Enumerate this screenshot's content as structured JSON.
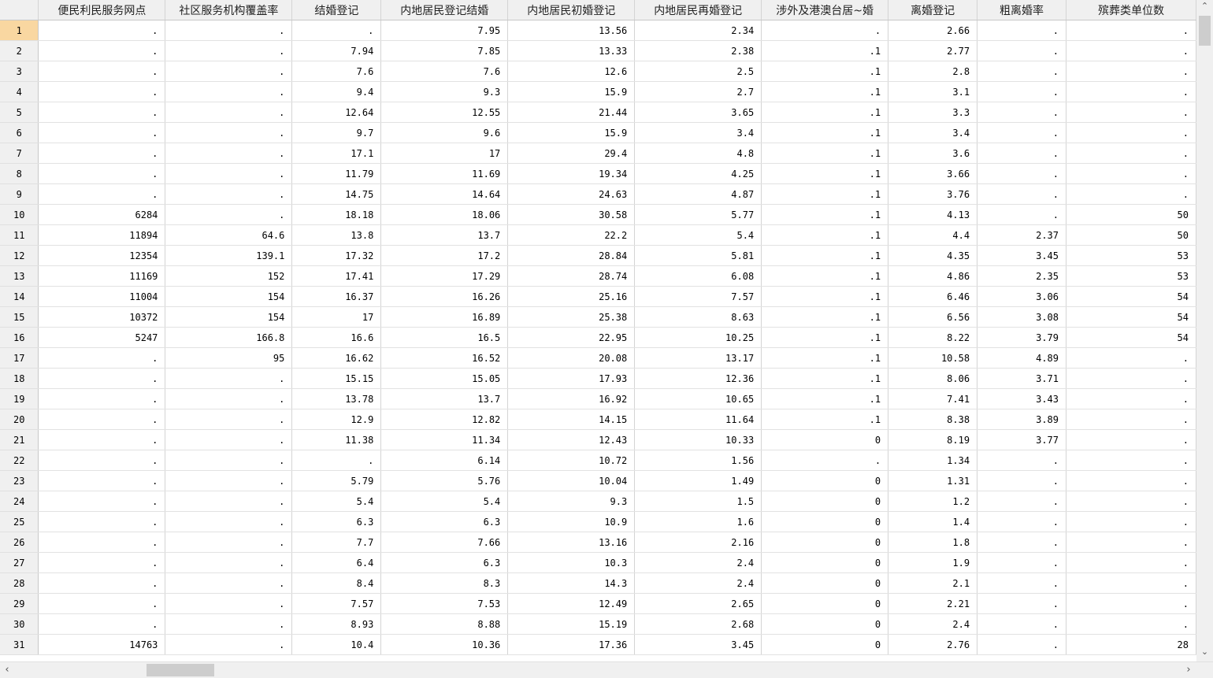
{
  "columns": [
    "便民利民服务网点",
    "社区服务机构覆盖率",
    "结婚登记",
    "内地居民登记结婚",
    "内地居民初婚登记",
    "内地居民再婚登记",
    "涉外及港澳台居~婚",
    "离婚登记",
    "粗离婚率",
    "殡葬类单位数"
  ],
  "selected_row": 1,
  "rows": [
    [
      "1",
      ".",
      ".",
      ".",
      "7.95",
      "13.56",
      "2.34",
      ".",
      "2.66",
      ".",
      "."
    ],
    [
      "2",
      ".",
      ".",
      "7.94",
      "7.85",
      "13.33",
      "2.38",
      ".1",
      "2.77",
      ".",
      "."
    ],
    [
      "3",
      ".",
      ".",
      "7.6",
      "7.6",
      "12.6",
      "2.5",
      ".1",
      "2.8",
      ".",
      "."
    ],
    [
      "4",
      ".",
      ".",
      "9.4",
      "9.3",
      "15.9",
      "2.7",
      ".1",
      "3.1",
      ".",
      "."
    ],
    [
      "5",
      ".",
      ".",
      "12.64",
      "12.55",
      "21.44",
      "3.65",
      ".1",
      "3.3",
      ".",
      "."
    ],
    [
      "6",
      ".",
      ".",
      "9.7",
      "9.6",
      "15.9",
      "3.4",
      ".1",
      "3.4",
      ".",
      "."
    ],
    [
      "7",
      ".",
      ".",
      "17.1",
      "17",
      "29.4",
      "4.8",
      ".1",
      "3.6",
      ".",
      "."
    ],
    [
      "8",
      ".",
      ".",
      "11.79",
      "11.69",
      "19.34",
      "4.25",
      ".1",
      "3.66",
      ".",
      "."
    ],
    [
      "9",
      ".",
      ".",
      "14.75",
      "14.64",
      "24.63",
      "4.87",
      ".1",
      "3.76",
      ".",
      "."
    ],
    [
      "10",
      "6284",
      ".",
      "18.18",
      "18.06",
      "30.58",
      "5.77",
      ".1",
      "4.13",
      ".",
      "50"
    ],
    [
      "11",
      "11894",
      "64.6",
      "13.8",
      "13.7",
      "22.2",
      "5.4",
      ".1",
      "4.4",
      "2.37",
      "50"
    ],
    [
      "12",
      "12354",
      "139.1",
      "17.32",
      "17.2",
      "28.84",
      "5.81",
      ".1",
      "4.35",
      "3.45",
      "53"
    ],
    [
      "13",
      "11169",
      "152",
      "17.41",
      "17.29",
      "28.74",
      "6.08",
      ".1",
      "4.86",
      "2.35",
      "53"
    ],
    [
      "14",
      "11004",
      "154",
      "16.37",
      "16.26",
      "25.16",
      "7.57",
      ".1",
      "6.46",
      "3.06",
      "54"
    ],
    [
      "15",
      "10372",
      "154",
      "17",
      "16.89",
      "25.38",
      "8.63",
      ".1",
      "6.56",
      "3.08",
      "54"
    ],
    [
      "16",
      "5247",
      "166.8",
      "16.6",
      "16.5",
      "22.95",
      "10.25",
      ".1",
      "8.22",
      "3.79",
      "54"
    ],
    [
      "17",
      ".",
      "95",
      "16.62",
      "16.52",
      "20.08",
      "13.17",
      ".1",
      "10.58",
      "4.89",
      "."
    ],
    [
      "18",
      ".",
      ".",
      "15.15",
      "15.05",
      "17.93",
      "12.36",
      ".1",
      "8.06",
      "3.71",
      "."
    ],
    [
      "19",
      ".",
      ".",
      "13.78",
      "13.7",
      "16.92",
      "10.65",
      ".1",
      "7.41",
      "3.43",
      "."
    ],
    [
      "20",
      ".",
      ".",
      "12.9",
      "12.82",
      "14.15",
      "11.64",
      ".1",
      "8.38",
      "3.89",
      "."
    ],
    [
      "21",
      ".",
      ".",
      "11.38",
      "11.34",
      "12.43",
      "10.33",
      "0",
      "8.19",
      "3.77",
      "."
    ],
    [
      "22",
      ".",
      ".",
      ".",
      "6.14",
      "10.72",
      "1.56",
      ".",
      "1.34",
      ".",
      "."
    ],
    [
      "23",
      ".",
      ".",
      "5.79",
      "5.76",
      "10.04",
      "1.49",
      "0",
      "1.31",
      ".",
      "."
    ],
    [
      "24",
      ".",
      ".",
      "5.4",
      "5.4",
      "9.3",
      "1.5",
      "0",
      "1.2",
      ".",
      "."
    ],
    [
      "25",
      ".",
      ".",
      "6.3",
      "6.3",
      "10.9",
      "1.6",
      "0",
      "1.4",
      ".",
      "."
    ],
    [
      "26",
      ".",
      ".",
      "7.7",
      "7.66",
      "13.16",
      "2.16",
      "0",
      "1.8",
      ".",
      "."
    ],
    [
      "27",
      ".",
      ".",
      "6.4",
      "6.3",
      "10.3",
      "2.4",
      "0",
      "1.9",
      ".",
      "."
    ],
    [
      "28",
      ".",
      ".",
      "8.4",
      "8.3",
      "14.3",
      "2.4",
      "0",
      "2.1",
      ".",
      "."
    ],
    [
      "29",
      ".",
      ".",
      "7.57",
      "7.53",
      "12.49",
      "2.65",
      "0",
      "2.21",
      ".",
      "."
    ],
    [
      "30",
      ".",
      ".",
      "8.93",
      "8.88",
      "15.19",
      "2.68",
      "0",
      "2.4",
      ".",
      "."
    ],
    [
      "31",
      "14763",
      ".",
      "10.4",
      "10.36",
      "17.36",
      "3.45",
      "0",
      "2.76",
      ".",
      "28"
    ]
  ],
  "scroll": {
    "up_arrow": "⌃",
    "down_arrow": "⌄",
    "left_arrow": "‹",
    "right_arrow": "›"
  }
}
